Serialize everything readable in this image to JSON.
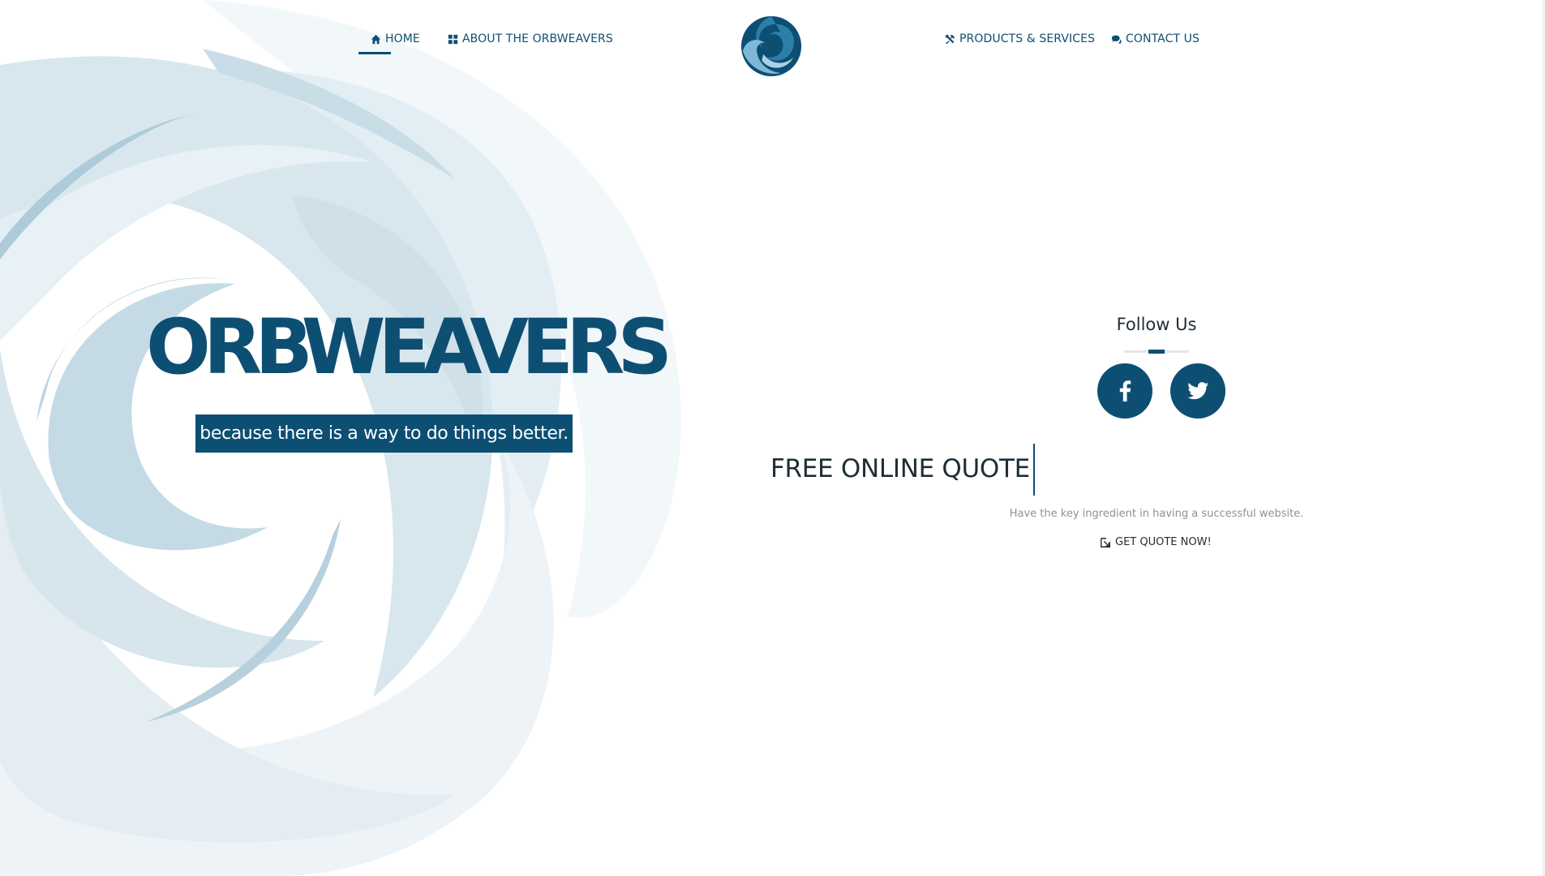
{
  "colors": {
    "brand": "#0d4f73",
    "text_dark": "#1f2d36",
    "text_muted": "#8a9298",
    "background": "#ffffff"
  },
  "nav": {
    "home": {
      "label": "HOME",
      "icon": "home-icon",
      "active": true
    },
    "about": {
      "label": "ABOUT THE ORBWEAVERS",
      "icon": "grid-icon"
    },
    "products": {
      "label": "PRODUCTS & SERVICES",
      "icon": "tools-icon"
    },
    "contact": {
      "label": "CONTACT US",
      "icon": "chat-bubbles-icon"
    }
  },
  "logo": {
    "icon": "orbweavers-swirl-logo"
  },
  "hero": {
    "title": "ORBWEAVERS",
    "tagline": "because there is a way to do things better."
  },
  "follow": {
    "title": "Follow Us",
    "networks": [
      {
        "name": "facebook",
        "icon": "facebook-icon"
      },
      {
        "name": "twitter",
        "icon": "twitter-icon"
      }
    ]
  },
  "quote": {
    "title": "FREE ONLINE QUOTE",
    "description": "Have the key ingredient in having a successful website.",
    "button_label": "GET QUOTE NOW!",
    "button_icon": "external-link-icon"
  }
}
